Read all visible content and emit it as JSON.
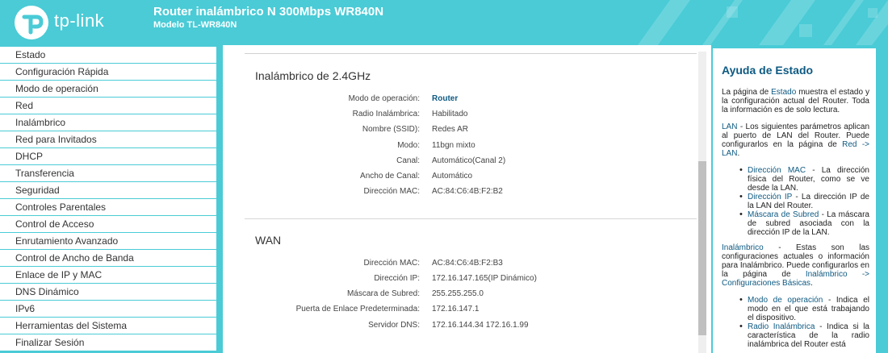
{
  "header": {
    "logo_text": "tp-link",
    "title": "Router inalámbrico N 300Mbps WR840N",
    "subtitle": "Modelo TL-WR840N"
  },
  "sidebar": {
    "items": [
      {
        "label": "Estado"
      },
      {
        "label": "Configuración Rápida"
      },
      {
        "label": "Modo de operación"
      },
      {
        "label": "Red"
      },
      {
        "label": "Inalámbrico"
      },
      {
        "label": "Red para Invitados"
      },
      {
        "label": "DHCP"
      },
      {
        "label": "Transferencia"
      },
      {
        "label": "Seguridad"
      },
      {
        "label": "Controles Parentales"
      },
      {
        "label": "Control de Acceso"
      },
      {
        "label": "Enrutamiento Avanzado"
      },
      {
        "label": "Control de Ancho de Banda"
      },
      {
        "label": "Enlace de IP y MAC"
      },
      {
        "label": "DNS Dinámico"
      },
      {
        "label": "IPv6"
      },
      {
        "label": "Herramientas del Sistema"
      },
      {
        "label": "Finalizar Sesión"
      }
    ]
  },
  "wireless": {
    "title": "Inalámbrico de 2.4GHz",
    "rows": [
      {
        "label": "Modo de operación:",
        "value": "Router"
      },
      {
        "label": "Radio Inalámbrica:",
        "value": "Habilitado"
      },
      {
        "label": "Nombre (SSID):",
        "value": "Redes AR"
      },
      {
        "label": "Modo:",
        "value": "11bgn mixto"
      },
      {
        "label": "Canal:",
        "value": "Automático(Canal 2)"
      },
      {
        "label": "Ancho de Canal:",
        "value": "Automático"
      },
      {
        "label": "Dirección MAC:",
        "value": "AC:84:C6:4B:F2:B2"
      }
    ]
  },
  "wan": {
    "title": "WAN",
    "rows": [
      {
        "label": "Dirección MAC:",
        "value": "AC:84:C6:4B:F2:B3"
      },
      {
        "label": "Dirección IP:",
        "value": "172.16.147.165(IP Dinámico)"
      },
      {
        "label": "Máscara de Subred:",
        "value": "255.255.255.0"
      },
      {
        "label": "Puerta de Enlace Predeterminada:",
        "value": "172.16.147.1"
      },
      {
        "label": "Servidor DNS:",
        "value": "172.16.144.34 172.16.1.99"
      }
    ]
  },
  "help": {
    "title": "Ayuda de Estado",
    "intro_1": "La página de ",
    "intro_hl": "Estado",
    "intro_2": " muestra el estado y la configuración actual del Router. Toda la información es de solo lectura.",
    "lan_hl": "LAN",
    "lan_text": " - Los siguientes parámetros aplican al puerto de LAN del Router. Puede configurarlos en la página de ",
    "lan_link": "Red -> LAN",
    "lan_end": ".",
    "lan_items": [
      {
        "term": "Dirección MAC",
        "desc": " - La dirección física del Router, como se ve desde la LAN."
      },
      {
        "term": "Dirección IP",
        "desc": " - La dirección IP de la LAN del Router."
      },
      {
        "term": "Máscara de Subred",
        "desc": " - La máscara de subred asociada con la dirección IP de la LAN."
      }
    ],
    "wl_hl": "Inalámbrico",
    "wl_text": " - Estas son las configuraciones actuales o información para Inalámbrico. Puede configurarlos en la página de ",
    "wl_link": "Inalámbrico -> Configuraciones Básicas",
    "wl_end": ".",
    "wl_items": [
      {
        "term": "Modo de operación",
        "desc": " - Indica el modo en el que está trabajando el dispositivo."
      },
      {
        "term": "Radio Inalámbrica",
        "desc": " - Indica si la característica de la radio inalámbrica del Router está"
      }
    ]
  }
}
